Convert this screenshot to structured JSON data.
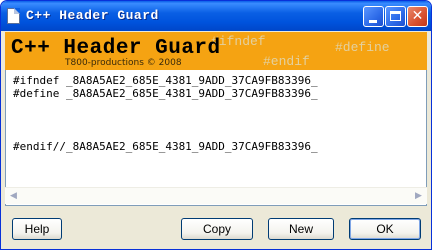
{
  "window": {
    "title": "C++ Header Guard"
  },
  "banner": {
    "title": "C++ Header Guard",
    "credit": "T800-productions © 2008",
    "bg_words": [
      "#ifndef",
      "#define",
      "#endif"
    ],
    "accent_color": "#f5a312"
  },
  "code": {
    "lines": [
      "#ifndef _8A8A5AE2_685E_4381_9ADD_37CA9FB83396_",
      "#define _8A8A5AE2_685E_4381_9ADD_37CA9FB83396_",
      "#endif//_8A8A5AE2_685E_4381_9ADD_37CA9FB83396_"
    ]
  },
  "buttons": {
    "help": "Help",
    "copy": "Copy",
    "new": "New",
    "ok": "OK"
  },
  "icons": {
    "window_icon": "document-icon",
    "minimize": "minimize-icon",
    "maximize": "maximize-icon",
    "close": "close-icon",
    "close_glyph": "✕",
    "scroll_left": "scroll-left-icon",
    "scroll_left_glyph": "◀",
    "scroll_right": "scroll-right-icon",
    "scroll_right_glyph": "▶"
  }
}
